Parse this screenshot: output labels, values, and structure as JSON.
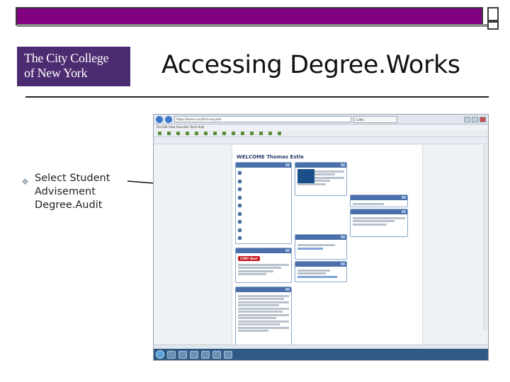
{
  "slide": {
    "title": "Accessing Degree.Works",
    "logo_line1": "The City College",
    "logo_line2": "of New York",
    "bullet_icon": "❖",
    "bullet_text": "Select Student Advisement Degree.Audit"
  },
  "colors": {
    "top_bar": "#800080",
    "logo_bg": "#4c2c70",
    "panel_header": "#4b6fab"
  },
  "browser": {
    "url": "https://home.cunyfirst.cuny.edu",
    "tab_label": "CUNY...",
    "menu_text": "File  Edit  View  Favorites  Tools  Help",
    "bookmarks": [
      "",
      "",
      "",
      "",
      "",
      "",
      "",
      "",
      "",
      "",
      "",
      "",
      "",
      ""
    ],
    "portal_links_text": "",
    "welcome_text": "WELCOME Thomas Estle",
    "quick_links": [
      "",
      "",
      "",
      "",
      "",
      "",
      "",
      "",
      ""
    ],
    "cuny_badge": "CUNY Alert",
    "taskbar_clock": ""
  }
}
